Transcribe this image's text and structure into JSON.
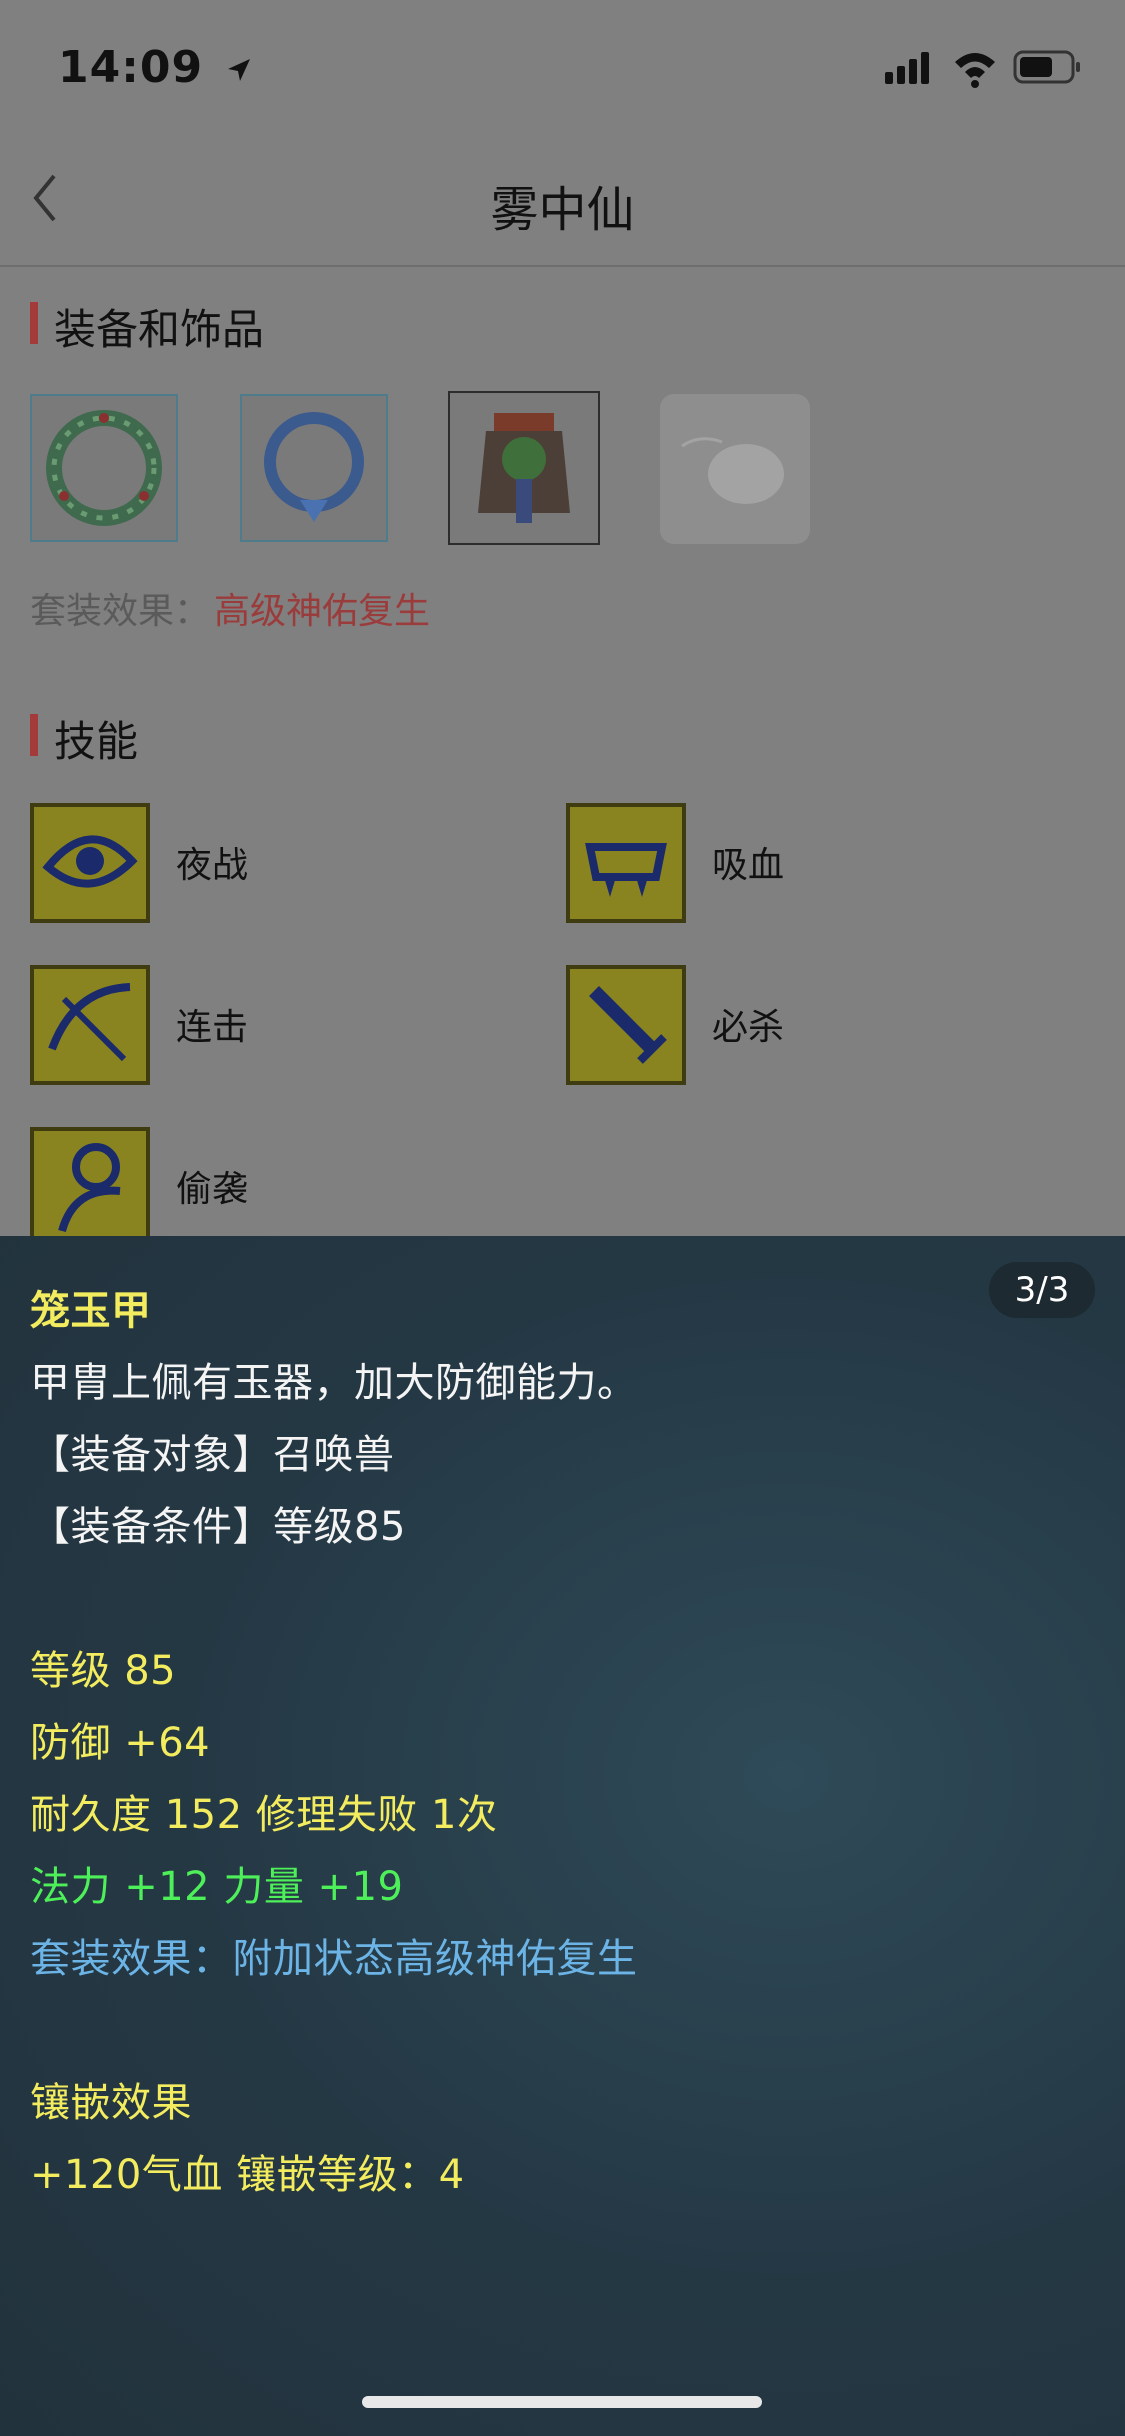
{
  "status_bar": {
    "time": "14:09"
  },
  "header": {
    "title": "雾中仙"
  },
  "equipment_section": {
    "title": "装备和饰品",
    "suit_label": "套装效果：",
    "suit_value": "高级神佑复生"
  },
  "skills_section": {
    "title": "技能",
    "skills": [
      {
        "label": "夜战"
      },
      {
        "label": "吸血"
      },
      {
        "label": "连击"
      },
      {
        "label": "必杀"
      },
      {
        "label": "偷袭"
      }
    ]
  },
  "detail_panel": {
    "page_indicator": "3/3",
    "name": "笼玉甲",
    "description": "甲胄上佩有玉器，加大防御能力。",
    "target": "【装备对象】召唤兽",
    "condition": "【装备条件】等级85",
    "level": "等级 85",
    "defense": "防御 +64",
    "durability": "耐久度 152 修理失败 1次",
    "bonus": "法力 +12 力量 +19",
    "suit_effect": "套装效果：附加状态高级神佑复生",
    "inlay_title": "镶嵌效果",
    "inlay_value": "+120气血 镶嵌等级：4"
  },
  "colors": {
    "accent_red": "#a33b3b",
    "item_name_yellow": "#f2ec5e",
    "bonus_green": "#4ef05a",
    "suit_blue": "#6cb4e6"
  }
}
